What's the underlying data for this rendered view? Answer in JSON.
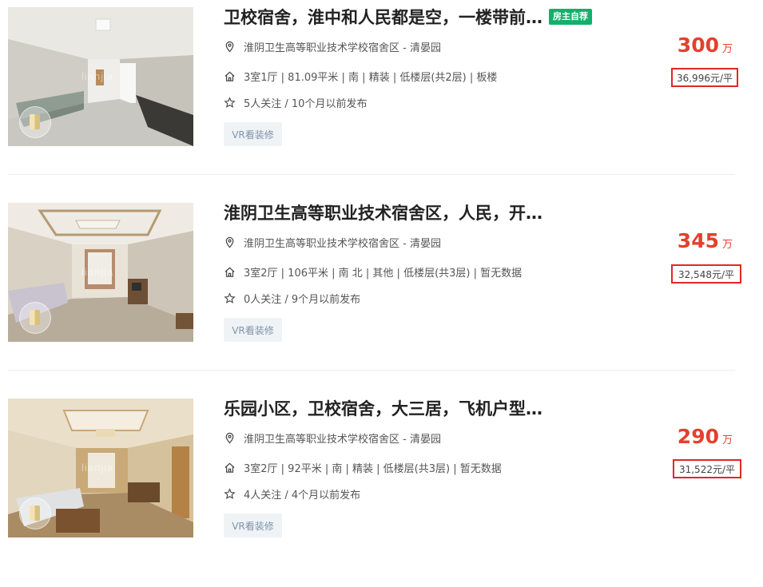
{
  "listings": [
    {
      "title": "卫校宿舍，淮中和人民都是空，一楼带前…",
      "tag": "房主自荐",
      "address": "淮阴卫生高等职业技术学校宿舍区 - 清晏园",
      "house_info": "3室1厅 | 81.09平米 | 南 | 精装 | 低楼层(共2层) | 板楼",
      "follow_info": "5人关注 / 10个月以前发布",
      "vr_label": "VR看装修",
      "total_price": "300",
      "total_unit": "万",
      "unit_price": "36,996元/平",
      "watermark": "lianjia",
      "icons": [
        "location-icon",
        "house-icon",
        "star-icon"
      ]
    },
    {
      "title": "淮阴卫生高等职业技术宿舍区，人民，开…",
      "tag": "",
      "address": "淮阴卫生高等职业技术学校宿舍区 - 清晏园",
      "house_info": "3室2厅 | 106平米 | 南 北 | 其他 | 低楼层(共3层) | 暂无数据",
      "follow_info": "0人关注 / 9个月以前发布",
      "vr_label": "VR看装修",
      "total_price": "345",
      "total_unit": "万",
      "unit_price": "32,548元/平",
      "watermark": "lianjia",
      "icons": [
        "location-icon",
        "house-icon",
        "star-icon"
      ]
    },
    {
      "title": "乐园小区，卫校宿舍，大三居，飞机户型…",
      "tag": "",
      "address": "淮阴卫生高等职业技术学校宿舍区 - 清晏园",
      "house_info": "3室2厅 | 92平米 | 南 | 精装 | 低楼层(共3层) | 暂无数据",
      "follow_info": "4人关注 / 4个月以前发布",
      "vr_label": "VR看装修",
      "total_price": "290",
      "total_unit": "万",
      "unit_price": "31,522元/平",
      "watermark": "lianjia",
      "icons": [
        "location-icon",
        "house-icon",
        "star-icon"
      ]
    }
  ],
  "colors": {
    "price": "#e2412d",
    "highlight_box": "#e32626",
    "tag_bg": "#12b06b",
    "vr_button_bg": "#f0f3f6",
    "vr_button_text": "#7d93a8"
  }
}
